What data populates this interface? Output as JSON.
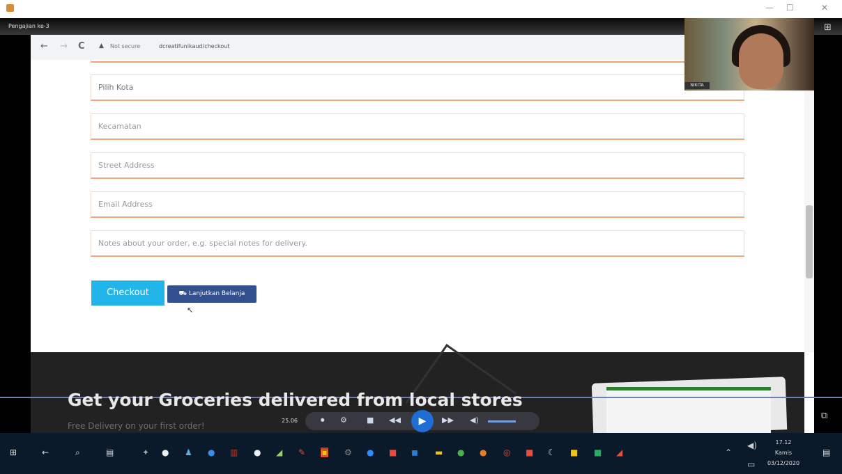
{
  "window": {
    "session_title": "Pengajian ke-3",
    "minimize": "—",
    "maximize": "☐",
    "close": "✕"
  },
  "browser": {
    "back_icon": "←",
    "forward_icon": "→",
    "reload_icon": "C",
    "security_text": "Not secure",
    "host": "dcreatifunikaud",
    "path": "/checkout",
    "url_full": "Not secure  dcreatifunikaud/checkout"
  },
  "form": {
    "city_placeholder": "Pilih Kota",
    "district_placeholder": "Kecamatan",
    "street_placeholder": "Street Address",
    "email_placeholder": "Email Address",
    "notes_placeholder": "Notes about your order, e.g. special notes for delivery."
  },
  "buttons": {
    "checkout": "Checkout",
    "continue_shopping": "Lanjutkan Belanja",
    "cart_icon": "🛒"
  },
  "banner": {
    "title": "Get your Groceries delivered from local stores",
    "subtitle": "Free Delivery on your first order!"
  },
  "webcam": {
    "label": "NIKITA"
  },
  "media": {
    "time": "25.06",
    "play_icon": "▶",
    "prev_icon": "◀◀",
    "next_icon": "▶▶",
    "stop_icon": "■",
    "volume_icon": "◀)"
  },
  "taskbar": {
    "time": "17.12",
    "day": "Kamis",
    "date": "03/12/2020"
  }
}
